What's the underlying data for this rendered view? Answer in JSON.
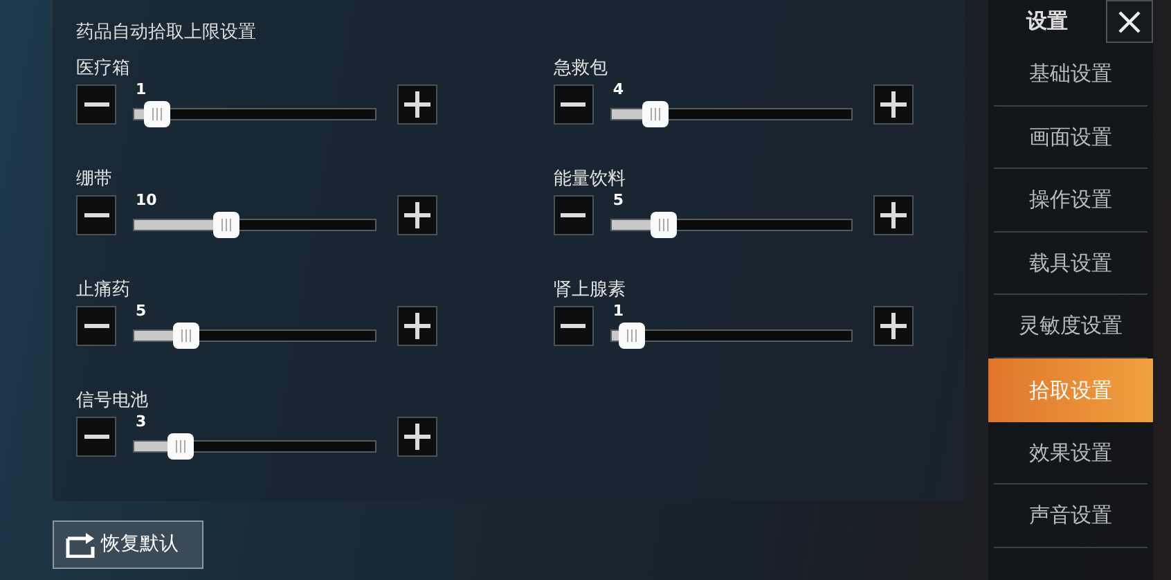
{
  "panel": {
    "title": "药品自动拾取上限设置",
    "items": [
      {
        "label": "医疗箱",
        "value": "1",
        "level": 0.04
      },
      {
        "label": "急救包",
        "value": "4",
        "level": 0.125
      },
      {
        "label": "绷带",
        "value": "10",
        "level": 0.33
      },
      {
        "label": "能量饮料",
        "value": "5",
        "level": 0.16
      },
      {
        "label": "止痛药",
        "value": "5",
        "level": 0.16
      },
      {
        "label": "肾上腺素",
        "value": "1",
        "level": 0.03
      },
      {
        "label": "信号电池",
        "value": "3",
        "level": 0.14
      }
    ]
  },
  "reset_button": "恢复默认",
  "sidebar": {
    "title": "设置",
    "items": [
      {
        "label": "基础设置",
        "selected": false
      },
      {
        "label": "画面设置",
        "selected": false
      },
      {
        "label": "操作设置",
        "selected": false
      },
      {
        "label": "载具设置",
        "selected": false
      },
      {
        "label": "灵敏度设置",
        "selected": false
      },
      {
        "label": "拾取设置",
        "selected": true
      },
      {
        "label": "效果设置",
        "selected": false
      },
      {
        "label": "声音设置",
        "selected": false
      }
    ]
  }
}
